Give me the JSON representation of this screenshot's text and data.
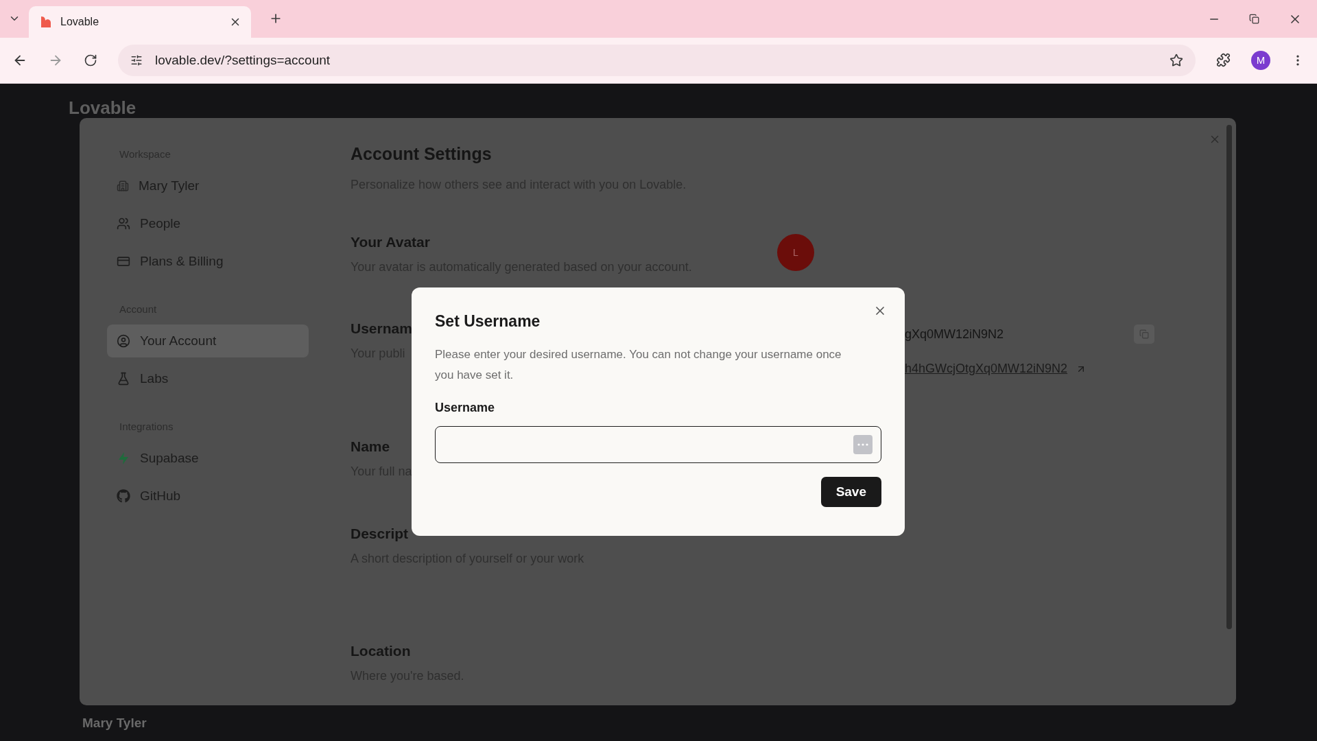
{
  "browser": {
    "tab_title": "Lovable",
    "url": "lovable.dev/?settings=account",
    "profile_initial": "M"
  },
  "page": {
    "logo": "Lovable",
    "footer_user": "Mary Tyler"
  },
  "sidebar": {
    "sections": [
      {
        "heading": "Workspace",
        "items": [
          {
            "label": "Mary Tyler",
            "selected": false
          },
          {
            "label": "People",
            "selected": false
          },
          {
            "label": "Plans & Billing",
            "selected": false
          }
        ]
      },
      {
        "heading": "Account",
        "items": [
          {
            "label": "Your Account",
            "selected": true
          },
          {
            "label": "Labs",
            "selected": false
          }
        ]
      },
      {
        "heading": "Integrations",
        "items": [
          {
            "label": "Supabase",
            "selected": false
          },
          {
            "label": "GitHub",
            "selected": false
          }
        ]
      }
    ]
  },
  "content": {
    "title": "Account Settings",
    "subtitle": "Personalize how others see and interact with you on Lovable.",
    "sections": [
      {
        "kind": "avatar",
        "title": "Your Avatar",
        "description": "Your avatar is automatically generated based on your account.",
        "avatar_letter": "L"
      },
      {
        "kind": "username",
        "title": "Usernam",
        "description": "Your publi",
        "value": "gXq0MW12iN9N2",
        "link": "h4hGWcjOtgXq0MW12iN9N2"
      },
      {
        "kind": "plain",
        "title": "Name",
        "description": "Your full na"
      },
      {
        "kind": "plain",
        "title": "Descript",
        "description": "A short description of yourself or your work"
      },
      {
        "kind": "plain",
        "title": "Location",
        "description": "Where you're based."
      }
    ]
  },
  "dialog": {
    "title": "Set Username",
    "description": "Please enter your desired username. You can not change your username once you have set it.",
    "field_label": "Username",
    "button": "Save"
  }
}
